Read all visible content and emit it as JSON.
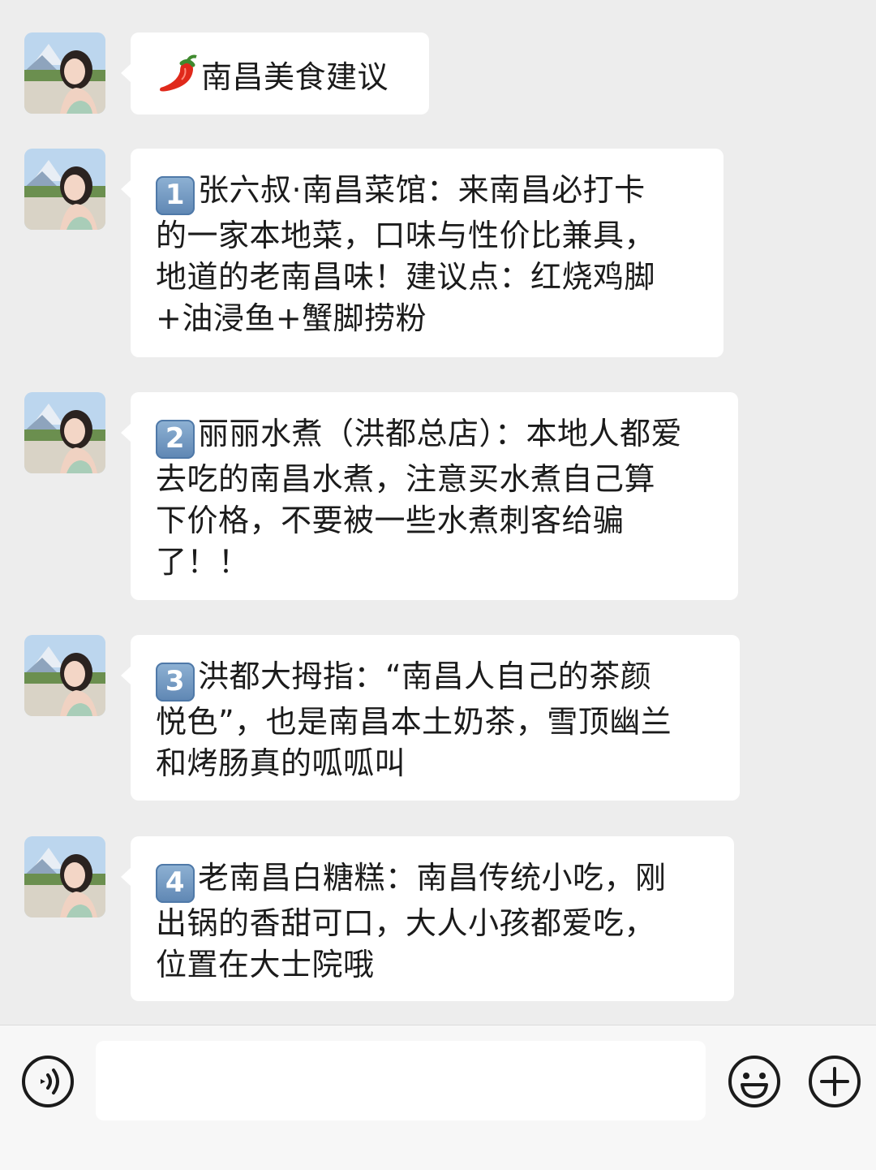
{
  "messages": [
    {
      "badge": "",
      "text": "南昌美食建议",
      "icon": "chili-pepper-icon"
    },
    {
      "badge": "1",
      "text": "张六叔·南昌菜馆：来南昌必打卡\n的一家本地菜，口味与性价比兼具，\n地道的老南昌味！建议点：红烧鸡脚\n+油浸鱼+蟹脚捞粉"
    },
    {
      "badge": "2",
      "text": "丽丽水煮（洪都总店）：本地人都爱\n去吃的南昌水煮，注意买水煮自己算\n下价格，不要被一些水煮刺客给骗\n了！！"
    },
    {
      "badge": "3",
      "text": "洪都大拇指：“南昌人自己的茶颜\n悦色”，也是南昌本土奶茶，雪顶幽兰\n和烤肠真的呱呱叫"
    },
    {
      "badge": "4",
      "text": "老南昌白糖糕：南昌传统小吃，刚\n出锅的香甜可口，大人小孩都爱吃，\n位置在大士院哦"
    }
  ],
  "input_bar": {
    "voice_icon": "voice-icon",
    "emoji_icon": "emoji-icon",
    "plus_icon": "plus-icon"
  },
  "colors": {
    "background": "#ededed",
    "bubble": "#ffffff",
    "badge": "#6b93bf"
  }
}
